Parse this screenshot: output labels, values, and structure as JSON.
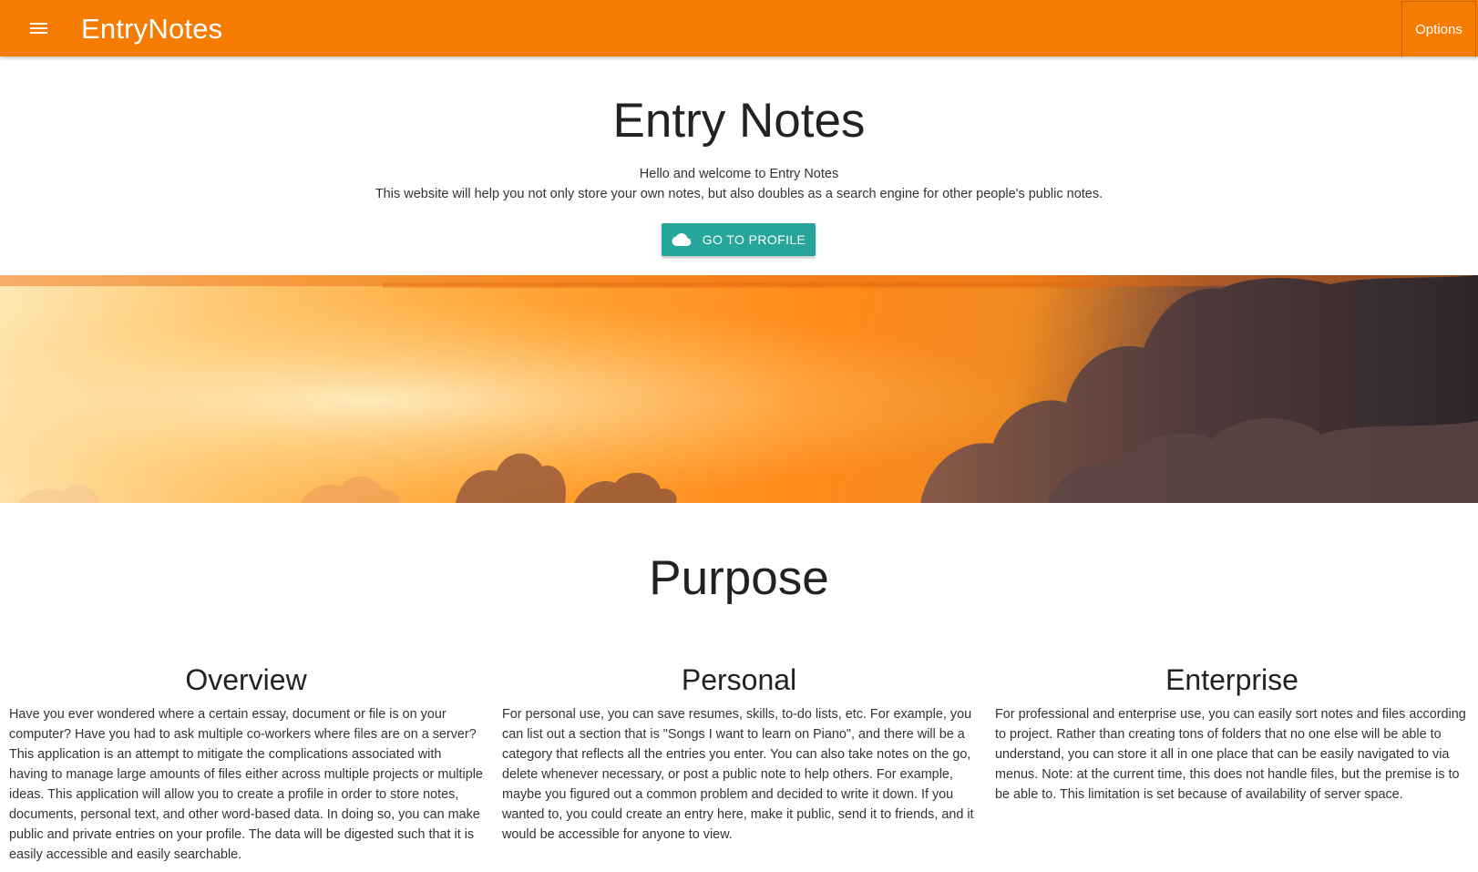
{
  "navbar": {
    "brand": "EntryNotes",
    "options_label": "Options",
    "color": "#f57c00"
  },
  "hero": {
    "title": "Entry Notes",
    "line1": "Hello and welcome to Entry Notes",
    "line2": "This website will help you not only store your own notes, but also doubles as a search engine for other people's public notes.",
    "button_label": "GO TO PROFILE",
    "button_icon": "cloud-icon",
    "button_color": "#26a69a"
  },
  "purpose": {
    "title": "Purpose",
    "columns": [
      {
        "heading": "Overview",
        "text": "Have you ever wondered where a certain essay, document or file is on your computer? Have you had to ask multiple co-workers where files are on a server? This application is an attempt to mitigate the complications associated with having to manage large amounts of files either across multiple projects or multiple ideas. This application will allow you to create a profile in order to store notes, documents, personal text, and other word-based data. In doing so, you can make public and private entries on your profile. The data will be digested such that it is easily accessible and easily searchable."
      },
      {
        "heading": "Personal",
        "text": "For personal use, you can save resumes, skills, to-do lists, etc. For example, you can list out a section that is \"Songs I want to learn on Piano\", and there will be a category that reflects all the entries you enter. You can also take notes on the go, delete whenever necessary, or post a public note to help others. For example, maybe you figured out a common problem and decided to write it down. If you wanted to, you could create an entry here, make it public, send it to friends, and it would be accessible for anyone to view."
      },
      {
        "heading": "Enterprise",
        "text": "For professional and enterprise use, you can easily sort notes and files according to project. Rather than creating tons of folders that no one else will be able to understand, you can store it all in one place that can be easily navigated to via menus. Note: at the current time, this does not handle files, but the premise is to be able to. This limitation is set because of availability of server space."
      }
    ]
  }
}
